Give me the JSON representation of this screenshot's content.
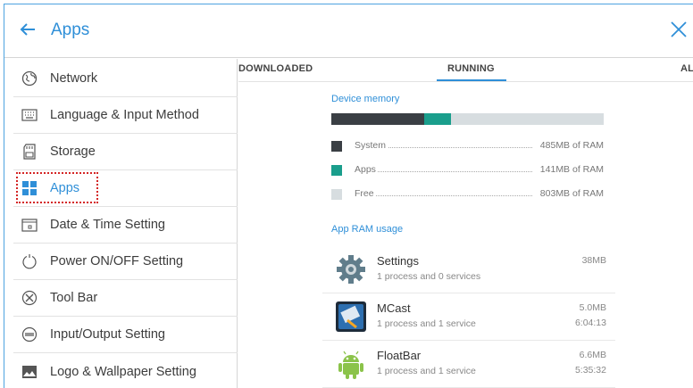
{
  "header": {
    "title": "Apps"
  },
  "sidebar": {
    "items": [
      {
        "label": "Network",
        "icon": "globe-icon"
      },
      {
        "label": "Language & Input Method",
        "icon": "keyboard-icon"
      },
      {
        "label": "Storage",
        "icon": "sd-card-icon"
      },
      {
        "label": "Apps",
        "icon": "apps-grid-icon",
        "active": true
      },
      {
        "label": "Date & Time Setting",
        "icon": "calendar-icon"
      },
      {
        "label": "Power ON/OFF Setting",
        "icon": "power-icon"
      },
      {
        "label": "Tool Bar",
        "icon": "tools-icon"
      },
      {
        "label": "Input/Output Setting",
        "icon": "input-output-icon"
      },
      {
        "label": "Logo & Wallpaper Setting",
        "icon": "image-icon"
      }
    ]
  },
  "tabs": {
    "downloaded": "DOWNLOADED",
    "running": "RUNNING",
    "all": "ALL",
    "active": "RUNNING"
  },
  "memory": {
    "title": "Device memory",
    "bar_fractions": {
      "system": 0.34,
      "apps": 0.1,
      "free": 0.56
    },
    "legend": [
      {
        "name": "System",
        "value": "485MB of RAM",
        "color": "#3a3f44"
      },
      {
        "name": "Apps",
        "value": "141MB of RAM",
        "color": "#1a9e8c"
      },
      {
        "name": "Free",
        "value": "803MB of RAM",
        "color": "#d7dde0"
      }
    ]
  },
  "app_usage": {
    "title": "App RAM usage",
    "apps": [
      {
        "name": "Settings",
        "desc": "1 process and 0 services",
        "size": "38MB",
        "time": "",
        "icon": "settings-gear-icon"
      },
      {
        "name": "MCast",
        "desc": "1 process and 1 service",
        "size": "5.0MB",
        "time": "6:04:13",
        "icon": "mcast-app-icon"
      },
      {
        "name": "FloatBar",
        "desc": "1 process and 1 service",
        "size": "6.6MB",
        "time": "5:35:32",
        "icon": "floatbar-app-icon"
      }
    ]
  },
  "colors": {
    "accent": "#2f8fd8",
    "highlight": "#d42525"
  }
}
